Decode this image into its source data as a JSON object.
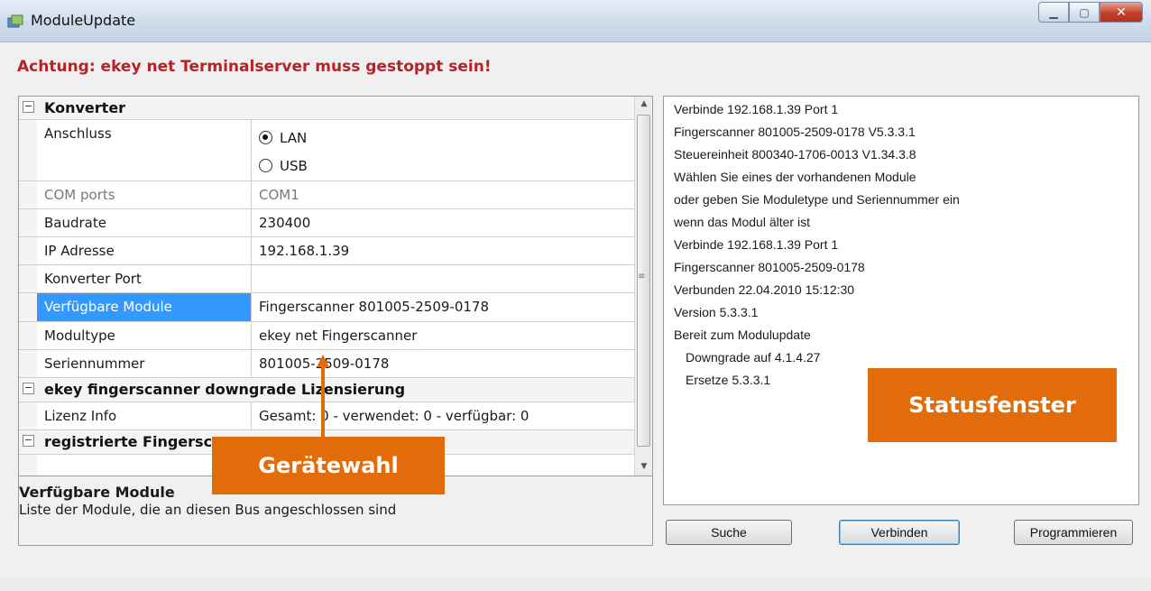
{
  "window": {
    "title": "ModuleUpdate"
  },
  "warning": "Achtung: ekey net Terminalserver muss gestoppt sein!",
  "grid": {
    "cat_konverter": "Konverter",
    "anschluss": {
      "name": "Anschluss",
      "opt_lan": "LAN",
      "opt_usb": "USB",
      "selected": "LAN"
    },
    "com_ports": {
      "name": "COM ports",
      "value": "COM1"
    },
    "baudrate": {
      "name": "Baudrate",
      "value": "230400"
    },
    "ip": {
      "name": "IP Adresse",
      "value": "192.168.1.39"
    },
    "konv_port": {
      "name": "Konverter Port",
      "value": ""
    },
    "module": {
      "name": "Verfügbare Module",
      "value": "Fingerscanner 801005-2509-0178"
    },
    "modultype": {
      "name": "Modultype",
      "value": "ekey net Fingerscanner"
    },
    "serial": {
      "name": "Seriennummer",
      "value": "801005-2509-0178"
    },
    "cat_downgrade": "ekey fingerscanner downgrade Lizensierung",
    "lizenz": {
      "name": "Lizenz Info",
      "value": "Gesamt: 0 - verwendet: 0 - verfügbar: 0"
    },
    "cat_registered": "registrierte Fingerscanner"
  },
  "description": {
    "title": "Verfügbare Module",
    "text": "Liste der Module, die an diesen Bus angeschlossen sind"
  },
  "status_lines": [
    "Verbinde 192.168.1.39 Port 1",
    "Fingerscanner 801005-2509-0178 V5.3.3.1",
    "Steuereinheit 800340-1706-0013 V1.34.3.8",
    "Wählen Sie eines der vorhandenen Module",
    "oder geben Sie Moduletype und Seriennummer ein",
    "wenn das Modul älter ist",
    "Verbinde 192.168.1.39 Port 1",
    "Fingerscanner 801005-2509-0178",
    "Verbunden 22.04.2010 15:12:30",
    "Version 5.3.3.1",
    "Bereit zum Modulupdate",
    "Downgrade auf 4.1.4.27",
    "Ersetze 5.3.3.1"
  ],
  "buttons": {
    "search": "Suche",
    "connect": "Verbinden",
    "program": "Programmieren"
  },
  "callouts": {
    "device": "Gerätewahl",
    "status": "Statusfenster"
  },
  "colors": {
    "callout": "#e36c0a",
    "warning": "#b3242a",
    "selection": "#3399ff"
  }
}
